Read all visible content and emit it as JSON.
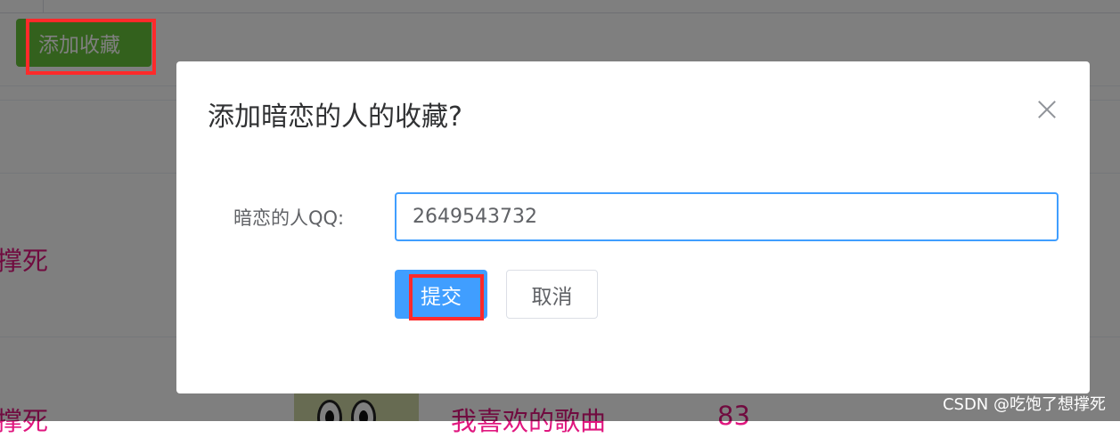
{
  "toolbar": {
    "add_favorite_label": "添加收藏"
  },
  "table": {
    "rows": [
      {
        "name_fragment": "撑死"
      },
      {
        "name_fragment": "撑死",
        "playlist_name": "我喜欢的歌曲",
        "count": "83"
      }
    ]
  },
  "dialog": {
    "title": "添加暗恋的人的收藏?",
    "field_label": "暗恋的人QQ:",
    "qq_value": "2649543732",
    "submit_label": "提交",
    "cancel_label": "取消"
  },
  "watermark": "CSDN @吃饱了想撑死",
  "colors": {
    "primary": "#409eff",
    "success": "#67c23a",
    "highlight": "#ff2a2a",
    "pink_text": "#e0177f"
  }
}
